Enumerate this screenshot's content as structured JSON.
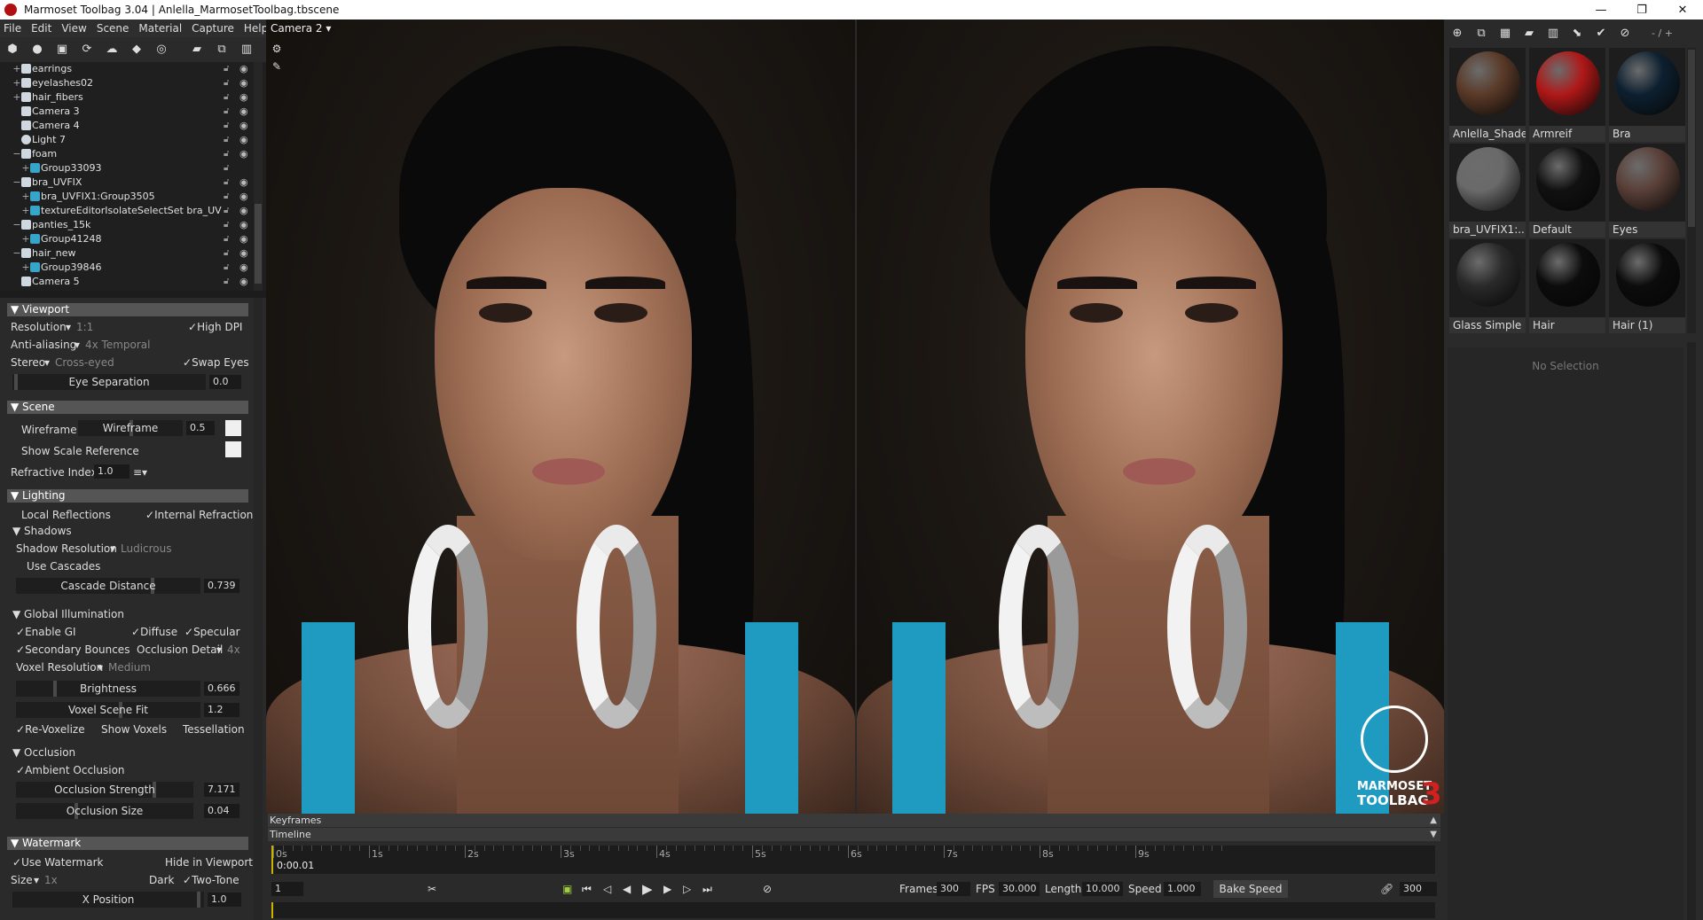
{
  "window": {
    "title": "Marmoset Toolbag 3.04  |  Anlella_MarmosetToolbag.tbscene",
    "minimize": "—",
    "maximize": "❐",
    "close": "✕"
  },
  "menu": [
    "File",
    "Edit",
    "View",
    "Scene",
    "Material",
    "Capture",
    "Help"
  ],
  "outliner": {
    "items": [
      {
        "label": "earrings",
        "icon": "object-icon"
      },
      {
        "label": "eyelashes02",
        "icon": "object-icon"
      },
      {
        "label": "hair_fibers",
        "icon": "object-icon"
      },
      {
        "label": "Camera 3",
        "icon": "camera-icon"
      },
      {
        "label": "Camera 4",
        "icon": "camera-icon"
      },
      {
        "label": "Light 7",
        "icon": "light-icon"
      },
      {
        "label": "foam",
        "icon": "object-icon"
      },
      {
        "label": "Group33093",
        "icon": "group-icon"
      },
      {
        "label": "bra_UVFIX",
        "icon": "object-icon"
      },
      {
        "label": "bra_UVFIX1:Group3505",
        "icon": "group-icon"
      },
      {
        "label": "textureEditorIsolateSelectSet bra_UV",
        "icon": "group-icon"
      },
      {
        "label": "panties_15k",
        "icon": "object-icon"
      },
      {
        "label": "Group41248",
        "icon": "group-icon"
      },
      {
        "label": "hair_new",
        "icon": "object-icon"
      },
      {
        "label": "Group39846",
        "icon": "group-icon"
      },
      {
        "label": "Camera 5",
        "icon": "camera-icon"
      }
    ]
  },
  "viewport_section": {
    "title": "Viewport",
    "resolution_label": "Resolution",
    "resolution_value": "1:1",
    "high_dpi": "High DPI",
    "aa_label": "Anti-aliasing",
    "aa_value": "4x Temporal",
    "stereo_label": "Stereo",
    "stereo_value": "Cross-eyed",
    "swap_eyes": "Swap Eyes",
    "eye_sep_label": "Eye Separation",
    "eye_sep_value": "0.0"
  },
  "scene_section": {
    "title": "Scene",
    "wireframe_label": "Wireframe",
    "wireframe_slider": "Wireframe",
    "wireframe_value": "0.5",
    "show_scale": "Show Scale Reference",
    "refractive_label": "Refractive Index",
    "refractive_value": "1.0"
  },
  "lighting_section": {
    "title": "Lighting",
    "local_reflections": "Local Reflections",
    "internal_refraction": "Internal Refraction",
    "shadows_title": "Shadows",
    "shadow_res_label": "Shadow Resolution",
    "shadow_res_value": "Ludicrous",
    "use_cascades": "Use Cascades",
    "cascade_label": "Cascade Distance",
    "cascade_value": "0.739",
    "gi_title": "Global Illumination",
    "enable_gi": "Enable GI",
    "diffuse": "Diffuse",
    "specular": "Specular",
    "secondary_bounces": "Secondary Bounces",
    "occlusion_detail_label": "Occlusion Detail",
    "occlusion_detail_value": "4x",
    "voxel_res_label": "Voxel Resolution",
    "voxel_res_value": "Medium",
    "brightness_label": "Brightness",
    "brightness_value": "0.666",
    "voxel_fit_label": "Voxel Scene Fit",
    "voxel_fit_value": "1.2",
    "re_voxelize": "Re-Voxelize",
    "show_voxels": "Show Voxels",
    "tessellation": "Tessellation",
    "occlusion_title": "Occlusion",
    "ambient_occlusion": "Ambient Occlusion",
    "occ_strength_label": "Occlusion Strength",
    "occ_strength_value": "7.171",
    "occ_size_label": "Occlusion Size",
    "occ_size_value": "0.04"
  },
  "watermark_section": {
    "title": "Watermark",
    "use_watermark": "Use Watermark",
    "hide_in_viewport": "Hide in Viewport",
    "size_label": "Size",
    "size_value": "1x",
    "dark": "Dark",
    "two_tone": "Two-Tone",
    "xpos_label": "X Position",
    "xpos_value": "1.0"
  },
  "viewport": {
    "camera_label": "Camera 2 ▾",
    "watermark_line1": "MARMOSET",
    "watermark_line2": "TOOLBAG",
    "watermark_num": "3"
  },
  "materials": {
    "pager": "- / +",
    "items": [
      {
        "name": "Anlella_Shader",
        "color": "#5a3a28"
      },
      {
        "name": "Armreif",
        "color": "#b01818"
      },
      {
        "name": "Bra",
        "color": "#0d2030"
      },
      {
        "name": "bra_UVFIX1:...",
        "color": "#6a6a6a"
      },
      {
        "name": "Default",
        "color": "#111111"
      },
      {
        "name": "Eyes",
        "color": "#5a4038"
      },
      {
        "name": "Glass Simple",
        "color": "#2a2a2a"
      },
      {
        "name": "Hair",
        "color": "#0c0c0c"
      },
      {
        "name": "Hair (1)",
        "color": "#0c0c0c"
      }
    ],
    "no_selection": "No Selection"
  },
  "timeline": {
    "keyframes_label": "Keyframes",
    "timeline_label": "Timeline",
    "ticks": [
      "0s",
      "1s",
      "2s",
      "3s",
      "4s",
      "5s",
      "6s",
      "7s",
      "8s",
      "9s"
    ],
    "current_time": "0:00.01",
    "frame_value": "1",
    "frames_label": "Frames",
    "frames_value": "300",
    "fps_label": "FPS",
    "fps_value": "30.000",
    "length_label": "Length",
    "length_value": "10.000",
    "speed_label": "Speed",
    "speed_value": "1.000",
    "bake_speed": "Bake Speed",
    "end_value": "300"
  },
  "colors": {
    "accent_yellow": "#c8b400",
    "strap_blue": "#1f9bc1",
    "logo_red": "#d02020"
  }
}
